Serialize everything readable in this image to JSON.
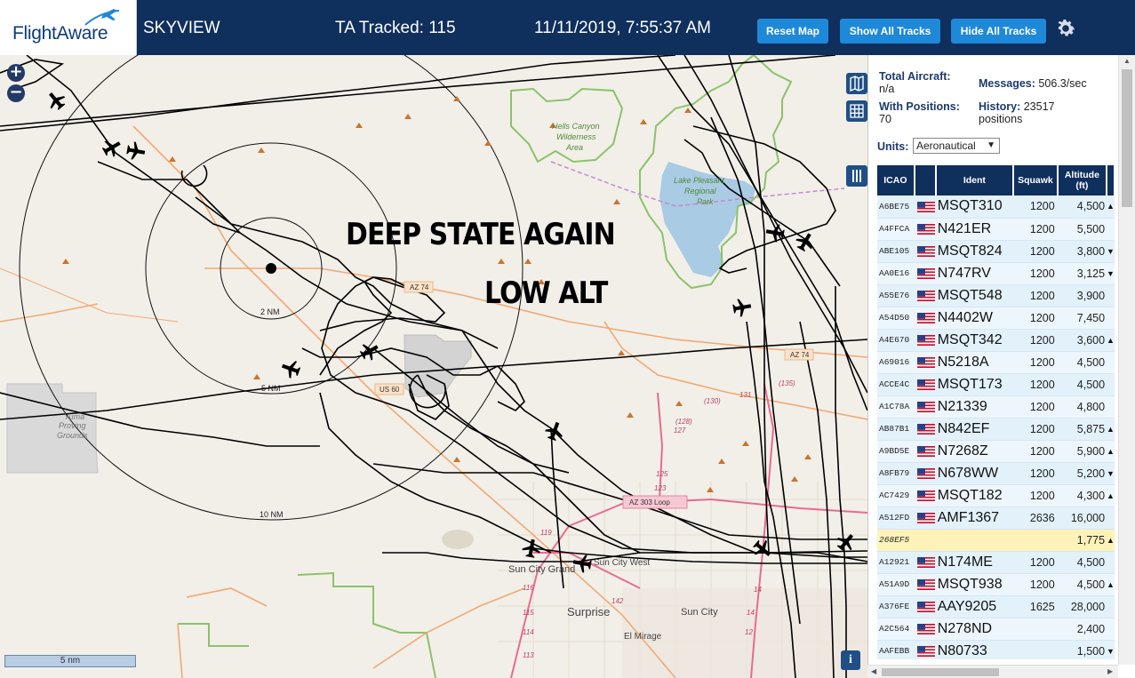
{
  "header": {
    "logo_text": "FlightAware",
    "app_name": "SKYVIEW",
    "tracked": "TA Tracked: 115",
    "datetime": "11/11/2019, 7:55:37 AM",
    "buttons": {
      "reset_map": "Reset Map",
      "show_all": "Show All Tracks",
      "hide_all": "Hide All Tracks"
    }
  },
  "map": {
    "zoom_in": "+",
    "zoom_out": "−",
    "scale_label": "5 nm",
    "info": "i",
    "annotations": [
      "DEEP STATE AGAIN",
      "LOW ALT"
    ],
    "range_rings": [
      "2 NM",
      "5 NM",
      "10 NM"
    ],
    "place_labels": {
      "hells_canyon": [
        "Hells Canyon",
        "Wilderness",
        "Area"
      ],
      "lake_pleasant": [
        "Lake Pleasant",
        "Regional",
        "Park"
      ],
      "yuma_proving": [
        "Yuma",
        "Proving",
        "Grounds"
      ],
      "sun_city_grand": "Sun City Grand",
      "sun_city_west": "Sun City West",
      "surprise": "Surprise",
      "sun_city": "Sun City",
      "el_mirage": "El Mirage"
    },
    "road_labels": {
      "az74_a": "AZ 74",
      "az74_b": "AZ 74",
      "us60": "US 60",
      "az303": "AZ 303 Loop",
      "r131": "131",
      "r135": "(135)",
      "r130": "(130)",
      "r128": "(128)",
      "r127": "127",
      "r125": "125",
      "r123": "123",
      "r119": "119",
      "r116": "116",
      "r115": "115",
      "r114": "114",
      "r113": "113",
      "r142": "142",
      "r14a": "14",
      "r14b": "14",
      "r12": "12"
    }
  },
  "sidebar": {
    "total_aircraft_label": "Total Aircraft:",
    "total_aircraft_value": "n/a",
    "messages_label": "Messages:",
    "messages_value": "506.3/sec",
    "with_positions_label": "With Positions:",
    "with_positions_value": "70",
    "history_label": "History:",
    "history_value": "23517",
    "history_unit": "positions",
    "units_label": "Units:",
    "units_value": "Aeronautical",
    "table": {
      "headers": {
        "icao": "ICAO",
        "ident": "Ident",
        "squawk": "Squawk",
        "altitude": "Altitude",
        "altitude_unit": "(ft)"
      },
      "rows": [
        {
          "icao": "A6BE75",
          "flag": true,
          "ident": "MSQT310",
          "squawk": "1200",
          "alt": "4,500",
          "trend": "▲"
        },
        {
          "icao": "A4FFCA",
          "flag": true,
          "ident": "N421ER",
          "squawk": "1200",
          "alt": "5,500",
          "trend": ""
        },
        {
          "icao": "ABE105",
          "flag": true,
          "ident": "MSQT824",
          "squawk": "1200",
          "alt": "3,800",
          "trend": "▼"
        },
        {
          "icao": "AA0E16",
          "flag": true,
          "ident": "N747RV",
          "squawk": "1200",
          "alt": "3,125",
          "trend": "▼"
        },
        {
          "icao": "A55E76",
          "flag": true,
          "ident": "MSQT548",
          "squawk": "1200",
          "alt": "3,900",
          "trend": ""
        },
        {
          "icao": "A54D50",
          "flag": true,
          "ident": "N4402W",
          "squawk": "1200",
          "alt": "7,450",
          "trend": ""
        },
        {
          "icao": "A4E670",
          "flag": true,
          "ident": "MSQT342",
          "squawk": "1200",
          "alt": "3,600",
          "trend": "▲"
        },
        {
          "icao": "A69016",
          "flag": true,
          "ident": "N5218A",
          "squawk": "1200",
          "alt": "4,500",
          "trend": ""
        },
        {
          "icao": "ACCE4C",
          "flag": true,
          "ident": "MSQT173",
          "squawk": "1200",
          "alt": "4,500",
          "trend": ""
        },
        {
          "icao": "A1C78A",
          "flag": true,
          "ident": "N21339",
          "squawk": "1200",
          "alt": "4,800",
          "trend": ""
        },
        {
          "icao": "AB87B1",
          "flag": true,
          "ident": "N842EF",
          "squawk": "1200",
          "alt": "5,875",
          "trend": "▲"
        },
        {
          "icao": "A9BD5E",
          "flag": true,
          "ident": "N7268Z",
          "squawk": "1200",
          "alt": "5,900",
          "trend": "▲"
        },
        {
          "icao": "A8FB79",
          "flag": true,
          "ident": "N678WW",
          "squawk": "1200",
          "alt": "5,200",
          "trend": "▼"
        },
        {
          "icao": "AC7429",
          "flag": true,
          "ident": "MSQT182",
          "squawk": "1200",
          "alt": "4,300",
          "trend": "▲"
        },
        {
          "icao": "A512FD",
          "flag": true,
          "ident": "AMF1367",
          "squawk": "2636",
          "alt": "16,000",
          "trend": ""
        },
        {
          "icao": "268EF5",
          "flag": false,
          "ident": "",
          "squawk": "",
          "alt": "1,775",
          "trend": "▲",
          "highlight": true
        },
        {
          "icao": "A12921",
          "flag": true,
          "ident": "N174ME",
          "squawk": "1200",
          "alt": "4,500",
          "trend": ""
        },
        {
          "icao": "A51A9D",
          "flag": true,
          "ident": "MSQT938",
          "squawk": "1200",
          "alt": "4,500",
          "trend": "▲"
        },
        {
          "icao": "A376FE",
          "flag": true,
          "ident": "AAY9205",
          "squawk": "1625",
          "alt": "28,000",
          "trend": ""
        },
        {
          "icao": "A2C564",
          "flag": true,
          "ident": "N278ND",
          "squawk": "",
          "alt": "2,400",
          "trend": ""
        },
        {
          "icao": "AAFEBB",
          "flag": true,
          "ident": "N80733",
          "squawk": "",
          "alt": "1,500",
          "trend": "▼"
        }
      ]
    }
  },
  "colors": {
    "header_bg": "#0f2f5c",
    "button_bg": "#1e88d9",
    "map_bg": "#f2efe9",
    "row_bg": "#e3f1fb",
    "row_highlight": "#fdf3b8",
    "water": "#a9cbe4",
    "park_outline": "#8cc26a",
    "road_orange": "#f1a972",
    "road_pink": "#e86b8f"
  }
}
